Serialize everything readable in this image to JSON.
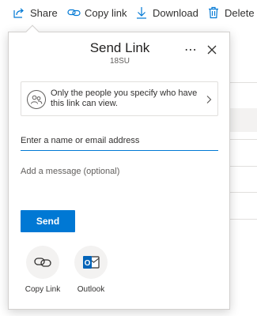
{
  "toolbar": {
    "share_label": "Share",
    "copy_link_label": "Copy link",
    "download_label": "Download",
    "delete_label": "Delete"
  },
  "dialog": {
    "title": "Send Link",
    "subtitle": "18SU",
    "permission_text": "Only the people you specify who have this link can view.",
    "name_placeholder": "Enter a name or email address",
    "message_placeholder": "Add a message (optional)",
    "send_label": "Send",
    "apps": [
      {
        "label": "Copy Link",
        "icon": "link-icon"
      },
      {
        "label": "Outlook",
        "icon": "outlook-icon"
      }
    ]
  },
  "colors": {
    "accent": "#0078d4",
    "outlook": "#0364b8"
  }
}
